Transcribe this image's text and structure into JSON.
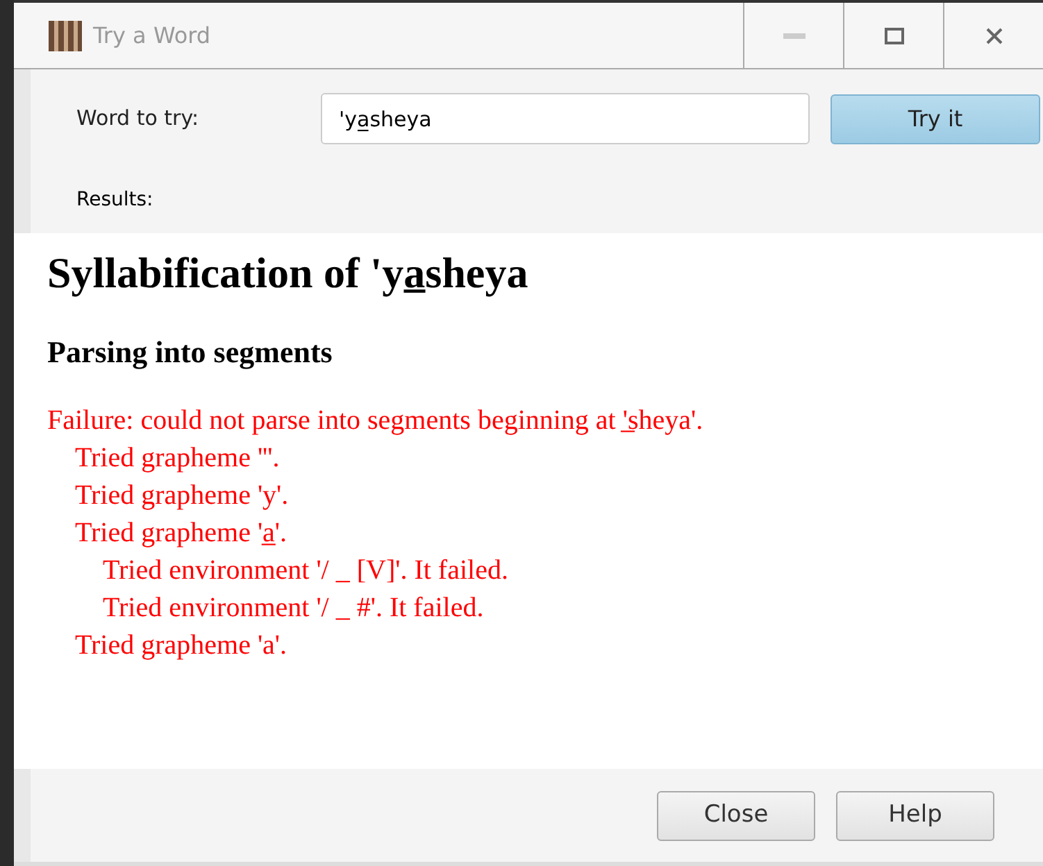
{
  "window": {
    "title": "Try a Word"
  },
  "word_field": {
    "label": "Word to try:",
    "value": "'ya̲sheya"
  },
  "try_button": "Try it",
  "results_label": "Results:",
  "results": {
    "title": "Syllabification of 'ya̲sheya",
    "section": "Parsing into segments",
    "messages": [
      {
        "text": "Failure: could not parse into segments beginning at '̲sheya'.",
        "children": [
          {
            "text": "Tried grapheme '''."
          },
          {
            "text": "Tried grapheme 'y'."
          },
          {
            "text": "Tried grapheme 'a̲'.",
            "children": [
              {
                "text": "Tried environment '/ _ [V]'. It failed."
              },
              {
                "text": "Tried environment '/ _ #'. It failed."
              }
            ]
          },
          {
            "text": "Tried grapheme 'a'."
          }
        ]
      }
    ]
  },
  "buttons": [
    "Close",
    "Help"
  ]
}
